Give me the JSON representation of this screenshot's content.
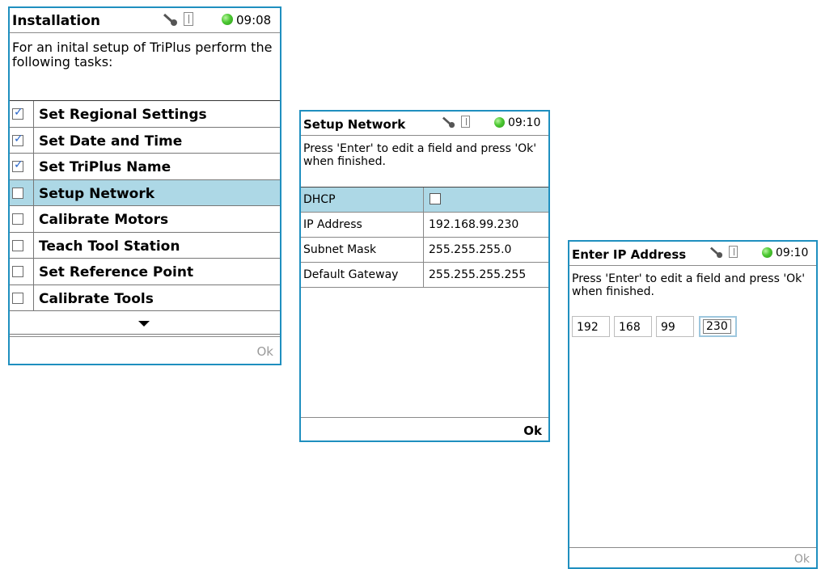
{
  "installation": {
    "title": "Installation",
    "time": "09:08",
    "description": "For an inital setup of TriPlus perform the following tasks:",
    "tasks": [
      {
        "label": "Set Regional Settings",
        "checked": true
      },
      {
        "label": "Set Date and Time",
        "checked": true
      },
      {
        "label": "Set TriPlus Name",
        "checked": true
      },
      {
        "label": "Setup Network",
        "checked": false,
        "selected": true
      },
      {
        "label": "Calibrate Motors",
        "checked": false
      },
      {
        "label": "Teach Tool Station",
        "checked": false
      },
      {
        "label": "Set Reference Point",
        "checked": false
      },
      {
        "label": "Calibrate Tools",
        "checked": false
      }
    ],
    "check_glyph": "✓",
    "ok_label": "Ok"
  },
  "setup_network": {
    "title": "Setup Network",
    "time": "09:10",
    "description": "Press 'Enter' to edit a field and press 'Ok' when finished.",
    "rows": [
      {
        "label": "DHCP",
        "value": "",
        "is_checkbox": true,
        "selected": true
      },
      {
        "label": "IP Address",
        "value": "192.168.99.230"
      },
      {
        "label": "Subnet Mask",
        "value": "255.255.255.0"
      },
      {
        "label": "Default Gateway",
        "value": "255.255.255.255"
      }
    ],
    "ok_label": "Ok"
  },
  "enter_ip": {
    "title": "Enter IP Address",
    "time": "09:10",
    "description": "Press 'Enter' to edit a field and press 'Ok' when finished.",
    "octets": [
      "192",
      "168",
      "99",
      "230"
    ],
    "ok_label": "Ok"
  },
  "icons": {
    "key": "key-icon",
    "usb": "usb-icon",
    "status": "status-light-icon"
  },
  "colors": {
    "panel_border": "#1f8fbf",
    "selection": "#add8e6",
    "status_green": "#4cc832",
    "check_blue": "#2a66c9"
  }
}
